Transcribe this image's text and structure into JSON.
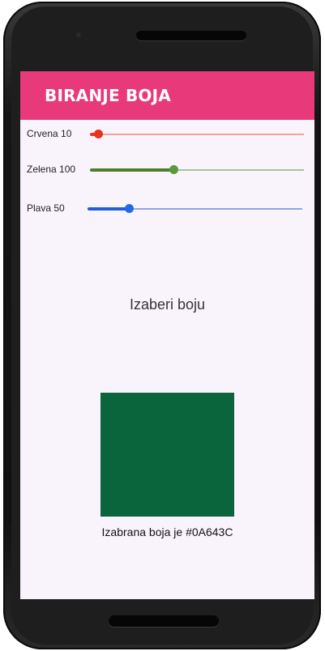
{
  "app": {
    "title": "BIRANJE BOJA"
  },
  "sliders": [
    {
      "key": "red",
      "label": "Crvena 10",
      "value": 10,
      "max": 255,
      "active_color": "#e8341c",
      "inactive_color": "#f0a39a",
      "thumb_color": "#e8341c"
    },
    {
      "key": "green",
      "label": "Zelena 100",
      "value": 100,
      "max": 255,
      "active_color": "#4e7e2c",
      "inactive_color": "#a9c199",
      "thumb_color": "#5a9a3c"
    },
    {
      "key": "blue",
      "label": "Plava 50",
      "value": 50,
      "max": 255,
      "active_color": "#1f5fd8",
      "inactive_color": "#8fa6e8",
      "thumb_color": "#1f6ae8"
    }
  ],
  "prompt": "Izaberi boju",
  "selected_color": "#0A643C",
  "result_text": "Izabrana boja je #0A643C",
  "colors": {
    "appbar": "#e8397a",
    "screen_bg": "#f9f4fc"
  }
}
